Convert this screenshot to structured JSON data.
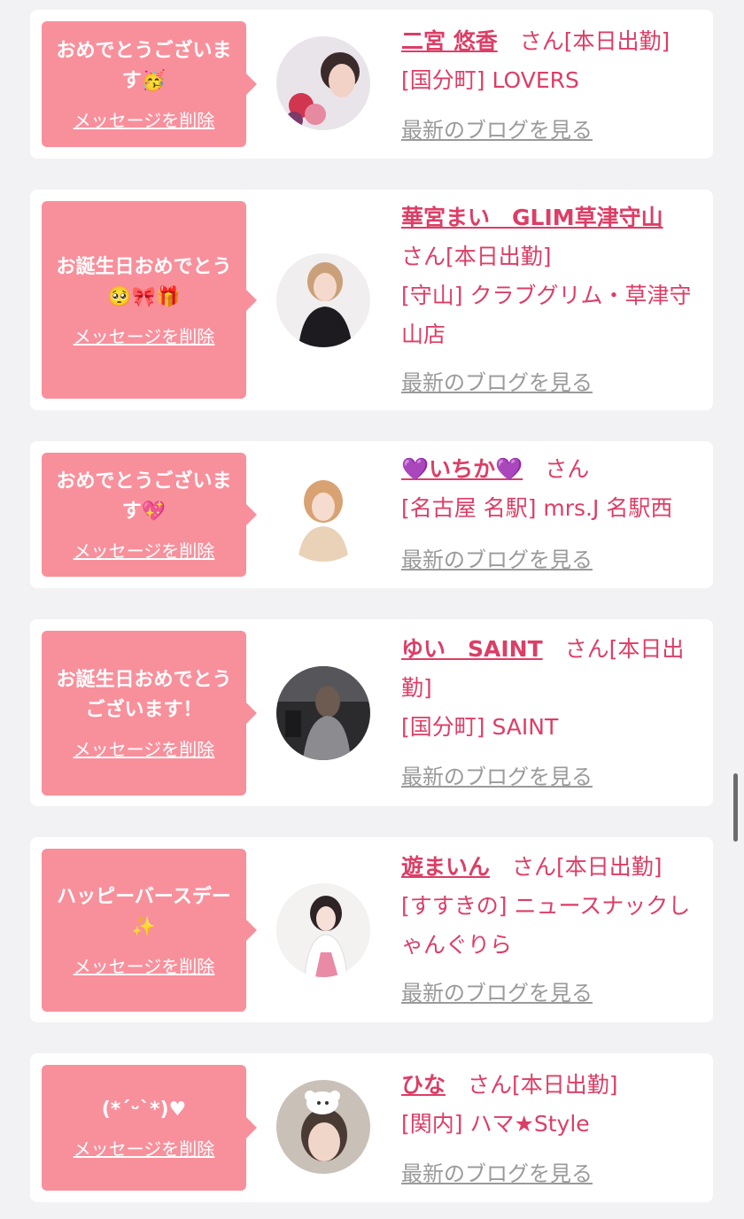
{
  "delete_label": "メッセージを削除",
  "blog_label": "最新のブログを見る",
  "san_label": "さん",
  "colors": {
    "bubble": "#f8909c",
    "accent": "#dc3e66",
    "link_gray": "#9a9a9a",
    "background": "#f2f2f4"
  },
  "cards": [
    {
      "message": "おめでとうございます🥳",
      "name": "二宮 悠香",
      "status": "[本日出勤]",
      "shop": "[国分町] LOVERS"
    },
    {
      "message": "お誕生日おめでとう🥺🎀🎁",
      "name": "華宮まい　GLIM草津守山",
      "status": "[本日出勤]",
      "shop": "[守山] クラブグリム・草津守山店"
    },
    {
      "message": "おめでとうございます💖",
      "name": "💜いちか💜",
      "status": "",
      "shop": "[名古屋 名駅] mrs.J 名駅西"
    },
    {
      "message": "お誕生日おめでとうございます！",
      "name": "ゆい　SAINT",
      "status": "[本日出勤]",
      "shop": "[国分町] SAINT"
    },
    {
      "message": "ハッピーバースデー✨",
      "name": "遊まいん",
      "status": "[本日出勤]",
      "shop": "[すすきの] ニュースナックしゃんぐりら"
    },
    {
      "message": "(*ˊᵕˋ*)♥",
      "name": "ひな",
      "status": "[本日出勤]",
      "shop": "[関内] ハマ★Style"
    }
  ]
}
